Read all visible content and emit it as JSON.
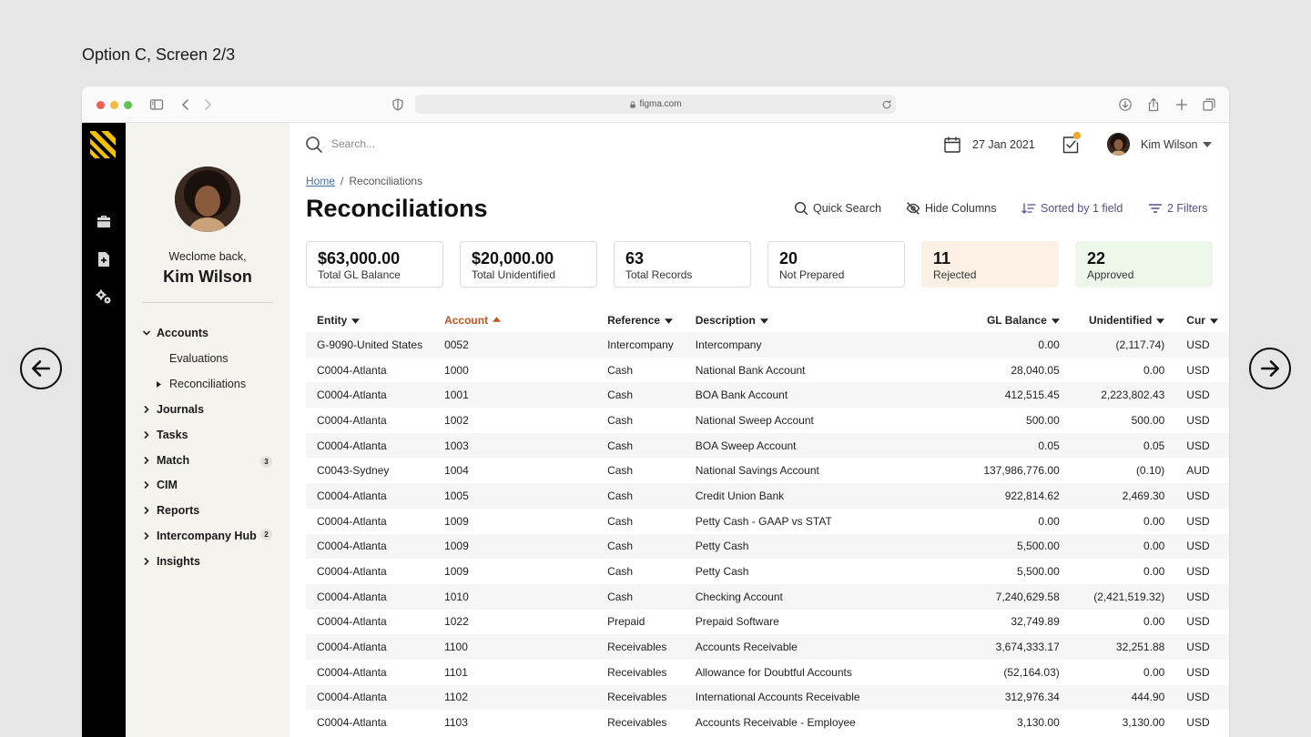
{
  "caption": "Option C, Screen 2/3",
  "browser": {
    "url": "figma.com"
  },
  "sidebar": {
    "welcome": "Weclome back,",
    "user_name": "Kim Wilson",
    "nav": [
      {
        "label": "Accounts",
        "expanded": true
      },
      {
        "label": "Evaluations"
      },
      {
        "label": "Reconciliations"
      },
      {
        "label": "Journals"
      },
      {
        "label": "Tasks"
      },
      {
        "label": "Match",
        "badge": "3"
      },
      {
        "label": "CIM"
      },
      {
        "label": "Reports"
      },
      {
        "label": "Intercompany Hub",
        "badge": "2"
      },
      {
        "label": "Insights"
      }
    ]
  },
  "topbar": {
    "search_placeholder": "Search...",
    "date": "27 Jan 2021",
    "user_name": "Kim Wilson"
  },
  "breadcrumb": {
    "home": "Home",
    "separator": "/",
    "current": "Reconciliations"
  },
  "page_title": "Reconciliations",
  "toolbar": {
    "quick_search": "Quick Search",
    "hide_columns": "Hide Columns",
    "sorted": "Sorted by 1 field",
    "filters": "2 Filters"
  },
  "cards": [
    {
      "value": "$63,000.00",
      "label": "Total GL Balance",
      "bg": "#ffffff"
    },
    {
      "value": "$20,000.00",
      "label": "Total Unidentified",
      "bg": "#ffffff"
    },
    {
      "value": "63",
      "label": "Total Records",
      "bg": "#ffffff"
    },
    {
      "value": "20",
      "label": "Not Prepared",
      "bg": "#ffffff"
    },
    {
      "value": "11",
      "label": "Rejected",
      "bg": "#fdf1e6"
    },
    {
      "value": "22",
      "label": "Approved",
      "bg": "#eef8ea"
    }
  ],
  "table": {
    "columns": [
      "Entity",
      "Account",
      "Reference",
      "Description",
      "GL Balance",
      "Unidentified",
      "Cur"
    ],
    "rows": [
      [
        "G-9090-United States",
        "0052",
        "Intercompany",
        "Intercompany",
        "0.00",
        "(2,117.74)",
        "USD"
      ],
      [
        "C0004-Atlanta",
        "1000",
        "Cash",
        "National Bank Account",
        "28,040.05",
        "0.00",
        "USD"
      ],
      [
        "C0004-Atlanta",
        "1001",
        "Cash",
        "BOA Bank Account",
        "412,515.45",
        "2,223,802.43",
        "USD"
      ],
      [
        "C0004-Atlanta",
        "1002",
        "Cash",
        "National Sweep Account",
        "500.00",
        "500.00",
        "USD"
      ],
      [
        "C0004-Atlanta",
        "1003",
        "Cash",
        "BOA Sweep Account",
        "0.05",
        "0.05",
        "USD"
      ],
      [
        "C0043-Sydney",
        "1004",
        "Cash",
        "National Savings Account",
        "137,986,776.00",
        "(0.10)",
        "AUD"
      ],
      [
        "C0004-Atlanta",
        "1005",
        "Cash",
        "Credit Union Bank",
        "922,814.62",
        "2,469.30",
        "USD"
      ],
      [
        "C0004-Atlanta",
        "1009",
        "Cash",
        "Petty Cash - GAAP vs STAT",
        "0.00",
        "0.00",
        "USD"
      ],
      [
        "C0004-Atlanta",
        "1009",
        "Cash",
        "Petty Cash",
        "5,500.00",
        "0.00",
        "USD"
      ],
      [
        "C0004-Atlanta",
        "1009",
        "Cash",
        "Petty Cash",
        "5,500.00",
        "0.00",
        "USD"
      ],
      [
        "C0004-Atlanta",
        "1010",
        "Cash",
        "Checking Account",
        "7,240,629.58",
        "(2,421,519.32)",
        "USD"
      ],
      [
        "C0004-Atlanta",
        "1022",
        "Prepaid",
        " Prepaid Software",
        "32,749.89",
        "0.00",
        "USD"
      ],
      [
        "C0004-Atlanta",
        "1100",
        "Receivables",
        "Accounts Receivable",
        "3,674,333.17",
        "32,251.88",
        "USD"
      ],
      [
        "C0004-Atlanta",
        "1101",
        "Receivables",
        "Allowance for Doubtful Accounts",
        "(52,164.03)",
        "0.00",
        "USD"
      ],
      [
        "C0004-Atlanta",
        "1102",
        "Receivables",
        "International Accounts Receivable",
        "312,976.34",
        "444.90",
        "USD"
      ],
      [
        "C0004-Atlanta",
        "1103",
        "Receivables",
        "Accounts Receivable - Employee",
        "3,130.00",
        "3,130.00",
        "USD"
      ]
    ]
  },
  "colors": {
    "accent_sort": "#c0541f",
    "rail": "#000000",
    "sidebar_bg": "#f5f3ee",
    "logo": "#f2c200"
  }
}
